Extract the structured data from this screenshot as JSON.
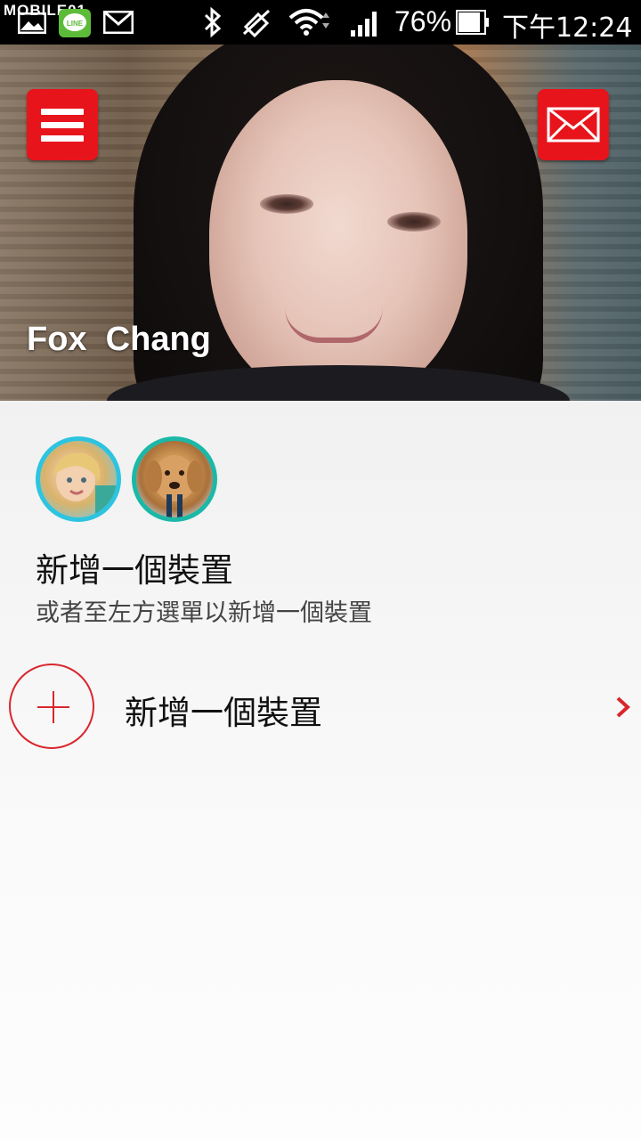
{
  "status_bar": {
    "watermark": "MOBILE01",
    "notification_icons": [
      "image-icon",
      "line-icon",
      "gmail-icon"
    ],
    "system_icons": [
      "bluetooth-icon",
      "vibrate-off-icon",
      "wifi-icon",
      "signal-icon",
      "battery-icon"
    ],
    "battery_percent": "76%",
    "time": "下午12:24"
  },
  "header": {
    "user_name": "Fox  Chang",
    "menu_icon": "hamburger-menu-icon",
    "mail_icon": "mail-envelope-icon",
    "accent_color": "#e8141c"
  },
  "devices": {
    "avatars": [
      {
        "name": "device-avatar-child",
        "ring_color": "#2cc4e0"
      },
      {
        "name": "device-avatar-dog",
        "ring_color": "#1bb8a8"
      }
    ],
    "title": "新增一個裝置",
    "subtitle": "或者至左方選單以新增一個裝置"
  },
  "add_device": {
    "label": "新增一個裝置",
    "icon": "plus-circle-icon",
    "chevron": "chevron-right-icon",
    "accent_color": "#d9262c"
  }
}
